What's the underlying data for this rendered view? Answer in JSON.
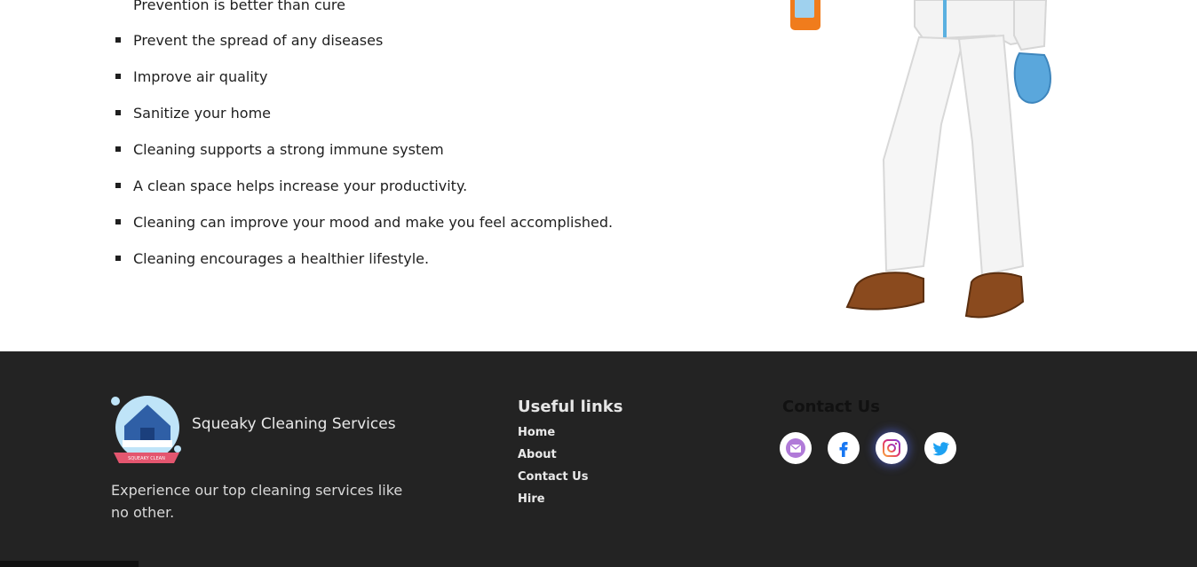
{
  "benefits": {
    "partial_item": "Prevention is better than cure",
    "items": [
      "Prevent the spread of any diseases",
      "Improve air quality",
      "Sanitize your home",
      "Cleaning supports a strong immune system",
      "A clean space helps increase your productivity.",
      "Cleaning can improve your mood and make you feel accomplished.",
      "Cleaning encourages a healthier lifestyle."
    ]
  },
  "illustration": {
    "icon": "cleaner-person-illustration"
  },
  "footer": {
    "brand": {
      "name": "Squeaky Cleaning Services",
      "logo_text": "SQUEAKY CLEAN",
      "tagline": "Experience our top cleaning services like no other."
    },
    "links": {
      "title": "Useful links",
      "items": [
        "Home",
        "About",
        "Contact Us",
        "Hire"
      ]
    },
    "contact": {
      "title": "Contact Us",
      "socials": [
        "email-icon",
        "facebook-icon",
        "instagram-icon",
        "twitter-icon"
      ]
    }
  },
  "colors": {
    "footer_bg": "#232323",
    "facebook": "#1877f2",
    "twitter": "#1da1f2",
    "email": "#b07ad8"
  }
}
